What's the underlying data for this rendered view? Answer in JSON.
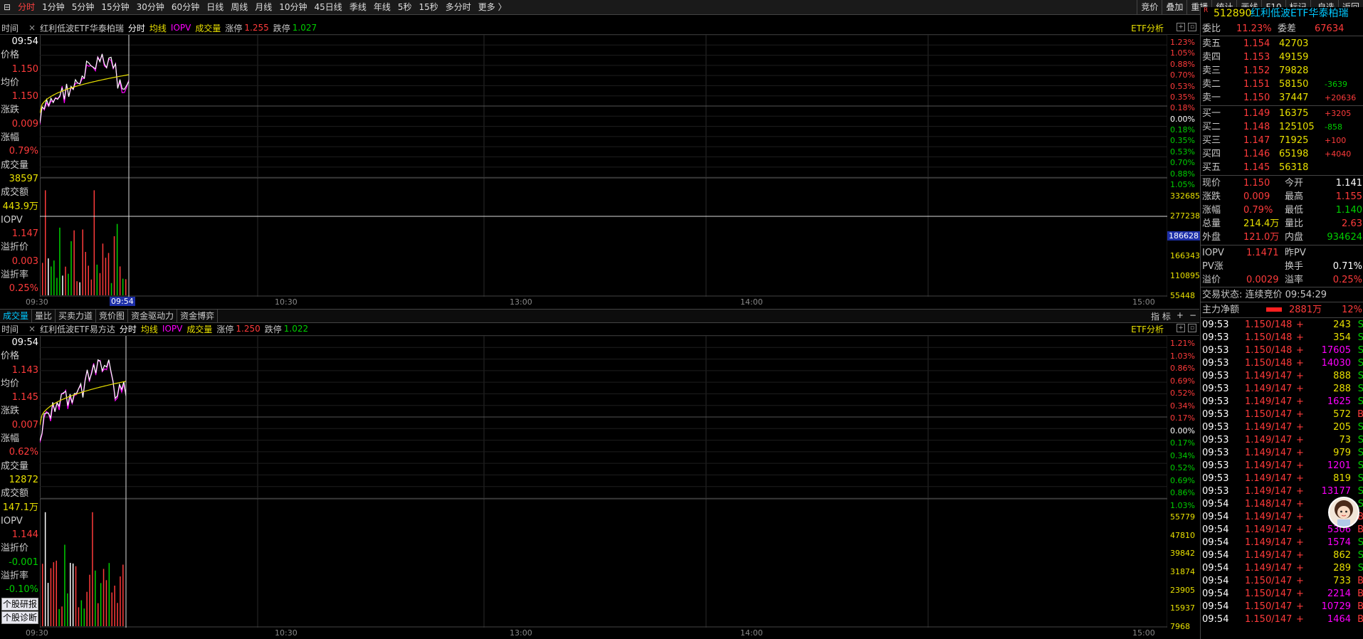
{
  "toolbar": {
    "items": [
      "分时",
      "1分钟",
      "5分钟",
      "15分钟",
      "30分钟",
      "60分钟",
      "日线",
      "周线",
      "月线",
      "10分钟",
      "45日线",
      "季线",
      "年线",
      "5秒",
      "15秒",
      "多分时",
      "更多 〉"
    ],
    "right_items": [
      "竞价",
      "叠加",
      "重播",
      "统计",
      "画线",
      "F10",
      "标记",
      "-自选",
      "返回"
    ]
  },
  "panel1": {
    "time_label": "时间",
    "name": "红利低波ETF华泰柏瑞",
    "fenshi": "分时",
    "junxian": "均线",
    "iopv": "IOPV",
    "volume": "成交量",
    "zhangting_label": "涨停",
    "zhangting": "1.255",
    "dieting_label": "跌停",
    "dieting": "1.027",
    "etf_btn": "ETF分析",
    "info": [
      {
        "label": "09:54",
        "value": ""
      },
      {
        "label": "价格",
        "value": "1.150"
      },
      {
        "label": "均价",
        "value": "1.150"
      },
      {
        "label": "涨跌",
        "value": "0.009"
      },
      {
        "label": "涨幅",
        "value": "0.79%"
      },
      {
        "label": "成交量",
        "value": "38597"
      },
      {
        "label": "成交额",
        "value": "443.9万"
      },
      {
        "label": "IOPV",
        "value": "1.147"
      },
      {
        "label": "溢折价",
        "value": "0.003"
      },
      {
        "label": "溢折率",
        "value": "0.25%"
      }
    ],
    "scale_pct": [
      "1.23%",
      "1.05%",
      "0.88%",
      "0.70%",
      "0.53%",
      "0.35%",
      "0.18%",
      "0.00%",
      "0.18%",
      "0.35%",
      "0.53%",
      "0.70%",
      "0.88%",
      "1.05%"
    ],
    "scale_vol": [
      "332685",
      "277238",
      "186628",
      "166343",
      "110895",
      "55448"
    ],
    "times": [
      "09:30",
      "10:30",
      "13:00",
      "14:00",
      "15:00"
    ],
    "cursor_time": "09:54"
  },
  "subtabs": [
    "成交量",
    "量比",
    "买卖力道",
    "竞价图",
    "资金驱动力",
    "资金博弈"
  ],
  "subtabs_right": [
    "指 标",
    "+",
    "−"
  ],
  "panel2": {
    "time_label": "时间",
    "name": "红利低波ETF易方达",
    "fenshi": "分时",
    "junxian": "均线",
    "iopv": "IOPV",
    "volume": "成交量",
    "zhangting_label": "涨停",
    "zhangting": "1.250",
    "dieting_label": "跌停",
    "dieting": "1.022",
    "etf_btn": "ETF分析",
    "info": [
      {
        "label": "09:54",
        "value": ""
      },
      {
        "label": "价格",
        "value": "1.143"
      },
      {
        "label": "均价",
        "value": "1.145"
      },
      {
        "label": "涨跌",
        "value": "0.007"
      },
      {
        "label": "涨幅",
        "value": "0.62%"
      },
      {
        "label": "成交量",
        "value": "12872"
      },
      {
        "label": "成交额",
        "value": "147.1万"
      },
      {
        "label": "IOPV",
        "value": "1.144"
      },
      {
        "label": "溢折价",
        "value": "-0.001"
      },
      {
        "label": "溢折率",
        "value": "-0.10%"
      }
    ],
    "buttons": [
      "个股研报",
      "个股诊断"
    ],
    "scale_pct": [
      "1.21%",
      "1.03%",
      "0.86%",
      "0.69%",
      "0.52%",
      "0.34%",
      "0.17%",
      "0.00%",
      "0.17%",
      "0.34%",
      "0.52%",
      "0.69%",
      "0.86%",
      "1.03%"
    ],
    "scale_vol": [
      "55779",
      "47810",
      "39842",
      "31874",
      "23905",
      "15937",
      "7968"
    ],
    "times": [
      "09:30",
      "10:30",
      "13:00",
      "14:00",
      "15:00"
    ]
  },
  "quote": {
    "badge": "R",
    "code": "512890",
    "name": "红利低波ETF华泰柏瑞",
    "weibi_label": "委比",
    "weibi": "11.23%",
    "weicha_label": "委差",
    "weicha": "67634",
    "asks": [
      {
        "label": "卖五",
        "price": "1.154",
        "vol": "42703",
        "chg": ""
      },
      {
        "label": "卖四",
        "price": "1.153",
        "vol": "49159",
        "chg": ""
      },
      {
        "label": "卖三",
        "price": "1.152",
        "vol": "79828",
        "chg": ""
      },
      {
        "label": "卖二",
        "price": "1.151",
        "vol": "58150",
        "chg": "-3639"
      },
      {
        "label": "卖一",
        "price": "1.150",
        "vol": "37447",
        "chg": "+20636"
      }
    ],
    "bids": [
      {
        "label": "买一",
        "price": "1.149",
        "vol": "16375",
        "chg": "+3205"
      },
      {
        "label": "买二",
        "price": "1.148",
        "vol": "125105",
        "chg": "-858"
      },
      {
        "label": "买三",
        "price": "1.147",
        "vol": "71925",
        "chg": "+100"
      },
      {
        "label": "买四",
        "price": "1.146",
        "vol": "65198",
        "chg": "+4040"
      },
      {
        "label": "买五",
        "price": "1.145",
        "vol": "56318",
        "chg": ""
      }
    ],
    "stats": [
      {
        "l1": "现价",
        "v1": "1.150",
        "l2": "今开",
        "v2": "1.141"
      },
      {
        "l1": "涨跌",
        "v1": "0.009",
        "l2": "最高",
        "v2": "1.155"
      },
      {
        "l1": "涨幅",
        "v1": "0.79%",
        "l2": "最低",
        "v2": "1.140"
      },
      {
        "l1": "总量",
        "v1": "214.4万",
        "l2": "量比",
        "v2": "2.63"
      },
      {
        "l1": "外盘",
        "v1": "121.0万",
        "l2": "内盘",
        "v2": "934624"
      }
    ],
    "iopv_stats": [
      {
        "l1": "IOPV",
        "v1": "1.1471",
        "l2": "昨PV",
        "v2": ""
      },
      {
        "l1": "PV涨",
        "v1": "",
        "l2": "换手",
        "v2": "0.71%"
      },
      {
        "l1": "溢价",
        "v1": "0.0029",
        "l2": "溢率",
        "v2": "0.25%"
      }
    ],
    "status": "交易状态: 连续竞价 09:54:29",
    "zhuli_label": "主力净额",
    "zhuli_value": "2881万",
    "zhuli_pct": "12%"
  },
  "ticks": [
    {
      "t": "09:53",
      "p": "1.150/148",
      "v": "243",
      "d": "S"
    },
    {
      "t": "09:53",
      "p": "1.150/148",
      "v": "354",
      "d": "S"
    },
    {
      "t": "09:53",
      "p": "1.150/148",
      "v": "17605",
      "d": "S"
    },
    {
      "t": "09:53",
      "p": "1.150/148",
      "v": "14030",
      "d": "S"
    },
    {
      "t": "09:53",
      "p": "1.149/147",
      "v": "888",
      "d": "S"
    },
    {
      "t": "09:53",
      "p": "1.149/147",
      "v": "288",
      "d": "S"
    },
    {
      "t": "09:53",
      "p": "1.149/147",
      "v": "1625",
      "d": "S"
    },
    {
      "t": "09:53",
      "p": "1.150/147",
      "v": "572",
      "d": "B"
    },
    {
      "t": "09:53",
      "p": "1.149/147",
      "v": "205",
      "d": "S"
    },
    {
      "t": "09:53",
      "p": "1.149/147",
      "v": "73",
      "d": "S"
    },
    {
      "t": "09:53",
      "p": "1.149/147",
      "v": "979",
      "d": "S"
    },
    {
      "t": "09:53",
      "p": "1.149/147",
      "v": "1201",
      "d": "S"
    },
    {
      "t": "09:53",
      "p": "1.149/147",
      "v": "819",
      "d": "S"
    },
    {
      "t": "09:53",
      "p": "1.149/147",
      "v": "13177",
      "d": "S"
    },
    {
      "t": "09:54",
      "p": "1.148/147",
      "v": "",
      "d": "S"
    },
    {
      "t": "09:54",
      "p": "1.149/147",
      "v": "1",
      "d": "B"
    },
    {
      "t": "09:54",
      "p": "1.149/147",
      "v": "5306",
      "d": "B"
    },
    {
      "t": "09:54",
      "p": "1.149/147",
      "v": "1574",
      "d": "S"
    },
    {
      "t": "09:54",
      "p": "1.149/147",
      "v": "862",
      "d": "S"
    },
    {
      "t": "09:54",
      "p": "1.149/147",
      "v": "289",
      "d": "S"
    },
    {
      "t": "09:54",
      "p": "1.150/147",
      "v": "733",
      "d": "B"
    },
    {
      "t": "09:54",
      "p": "1.150/147",
      "v": "2214",
      "d": "B"
    },
    {
      "t": "09:54",
      "p": "1.150/147",
      "v": "10729",
      "d": "B"
    },
    {
      "t": "09:54",
      "p": "1.150/147",
      "v": "1464",
      "d": "B"
    }
  ]
}
